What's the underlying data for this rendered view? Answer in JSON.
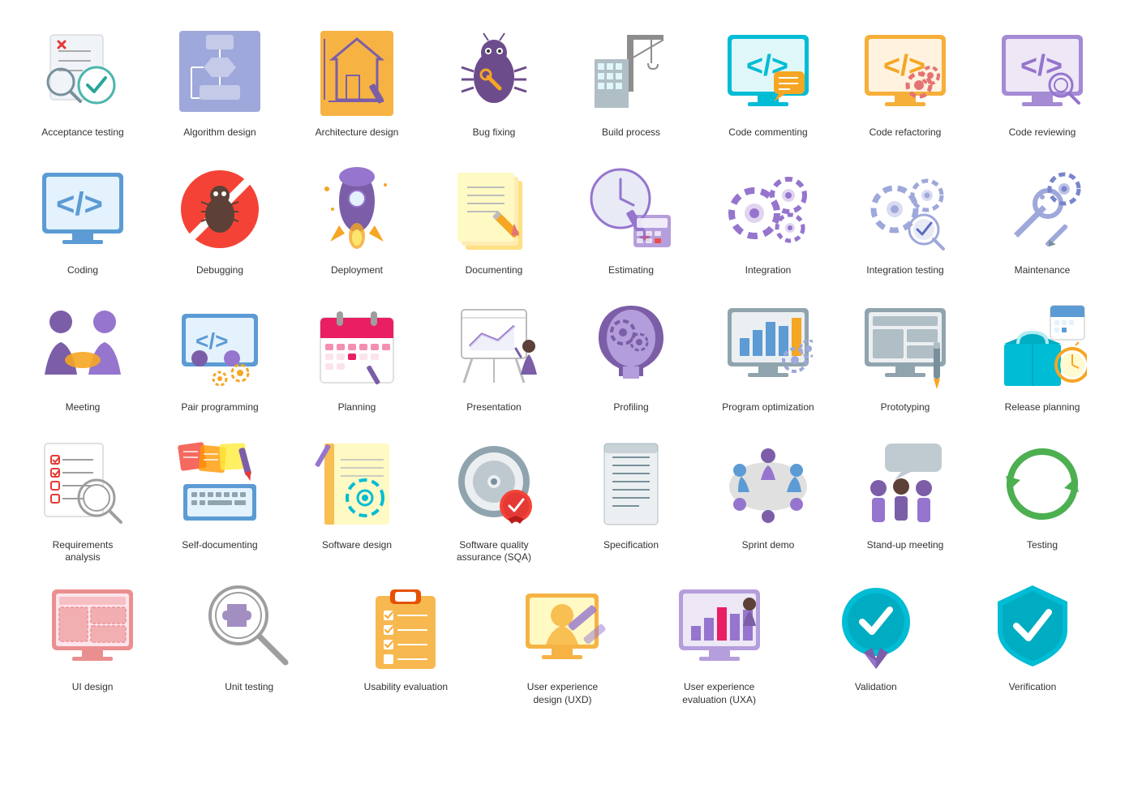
{
  "items": [
    {
      "id": "acceptance-testing",
      "label": "Acceptance testing"
    },
    {
      "id": "algorithm-design",
      "label": "Algorithm design"
    },
    {
      "id": "architecture-design",
      "label": "Architecture design"
    },
    {
      "id": "bug-fixing",
      "label": "Bug fixing"
    },
    {
      "id": "build-process",
      "label": "Build process"
    },
    {
      "id": "code-commenting",
      "label": "Code commenting"
    },
    {
      "id": "code-refactoring",
      "label": "Code refactoring"
    },
    {
      "id": "code-reviewing",
      "label": "Code reviewing"
    },
    {
      "id": "coding",
      "label": "Coding"
    },
    {
      "id": "debugging",
      "label": "Debugging"
    },
    {
      "id": "deployment",
      "label": "Deployment"
    },
    {
      "id": "documenting",
      "label": "Documenting"
    },
    {
      "id": "estimating",
      "label": "Estimating"
    },
    {
      "id": "integration",
      "label": "Integration"
    },
    {
      "id": "integration-testing",
      "label": "Integration testing"
    },
    {
      "id": "maintenance",
      "label": "Maintenance"
    },
    {
      "id": "meeting",
      "label": "Meeting"
    },
    {
      "id": "pair-programming",
      "label": "Pair programming"
    },
    {
      "id": "planning",
      "label": "Planning"
    },
    {
      "id": "presentation",
      "label": "Presentation"
    },
    {
      "id": "profiling",
      "label": "Profiling"
    },
    {
      "id": "program-optimization",
      "label": "Program optimization"
    },
    {
      "id": "prototyping",
      "label": "Prototyping"
    },
    {
      "id": "release-planning",
      "label": "Release planning"
    },
    {
      "id": "requirements-analysis",
      "label": "Requirements analysis"
    },
    {
      "id": "self-documenting",
      "label": "Self-documenting"
    },
    {
      "id": "software-design",
      "label": "Software design"
    },
    {
      "id": "software-quality-assurance",
      "label": "Software quality assurance (SQA)"
    },
    {
      "id": "specification",
      "label": "Specification"
    },
    {
      "id": "sprint-demo",
      "label": "Sprint demo"
    },
    {
      "id": "stand-up-meeting",
      "label": "Stand-up meeting"
    },
    {
      "id": "testing",
      "label": "Testing"
    },
    {
      "id": "ui-design",
      "label": "UI design"
    },
    {
      "id": "unit-testing",
      "label": "Unit testing"
    },
    {
      "id": "usability-evaluation",
      "label": "Usability evaluation"
    },
    {
      "id": "user-experience-design",
      "label": "User experience design (UXD)"
    },
    {
      "id": "user-experience-evaluation",
      "label": "User experience evaluation (UXA)"
    },
    {
      "id": "validation",
      "label": "Validation"
    },
    {
      "id": "verification",
      "label": "Verification"
    }
  ]
}
